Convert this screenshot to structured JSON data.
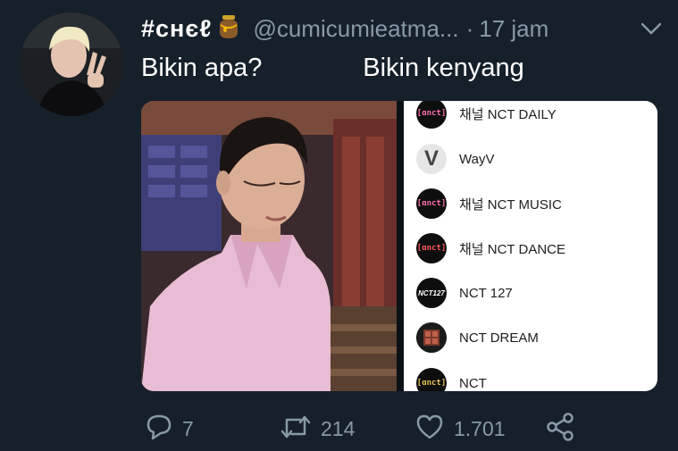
{
  "tweet": {
    "display_name": "#cʜєℓ",
    "name_emoji": "honey-pot-emoji",
    "handle": "@cumicumieatma...",
    "separator": "·",
    "time": "17 jam",
    "text": "Bikin apa?              Bikin kenyang"
  },
  "media": {
    "channels": [
      {
        "logo": "nct-daily-logo",
        "logo_text": "[ɑnct]",
        "name": "채널 NCT DAILY"
      },
      {
        "logo": "wayv-logo",
        "logo_text": "V",
        "name": "WayV"
      },
      {
        "logo": "nct-music-logo",
        "logo_text": "[ɑnct]",
        "name": "채널 NCT MUSIC"
      },
      {
        "logo": "nct-dance-logo",
        "logo_text": "[ɑnct]",
        "name": "채널 NCT DANCE"
      },
      {
        "logo": "nct127-logo",
        "logo_text": "NCT127",
        "name": "NCT 127"
      },
      {
        "logo": "nct-dream-logo",
        "logo_text": "",
        "name": "NCT DREAM"
      },
      {
        "logo": "nct-logo",
        "logo_text": "[ɑnct]",
        "name": "NCT"
      }
    ]
  },
  "actions": {
    "reply_count": "7",
    "retweet_count": "214",
    "like_count": "1.701"
  },
  "colors": {
    "background": "#15202b",
    "muted_text": "#8899a6",
    "text": "#ffffff"
  }
}
